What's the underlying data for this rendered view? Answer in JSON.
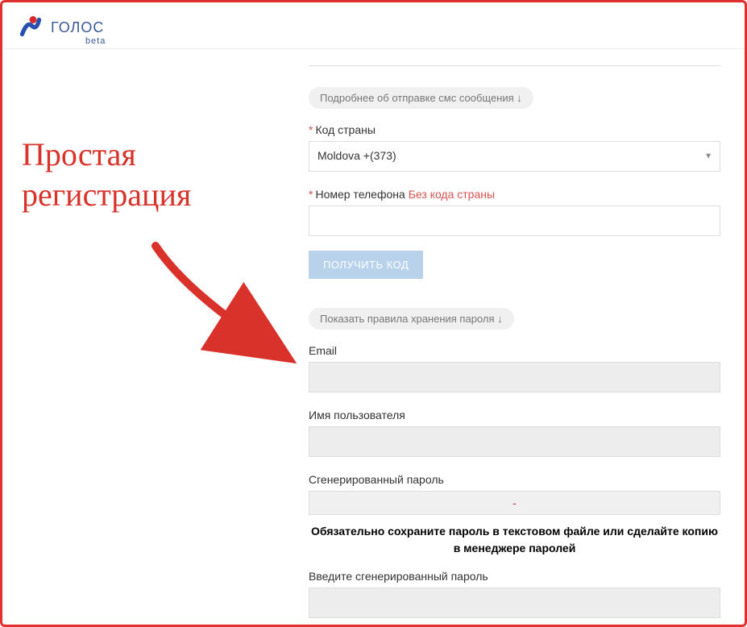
{
  "header": {
    "brand": "ГОЛОС",
    "beta": "beta"
  },
  "annotation": {
    "line1": "Простая",
    "line2": "регистрация"
  },
  "form": {
    "sms_more_label": "Подробнее об отправке смс сообщения ↓",
    "country_label": "Код страны",
    "country_value": "Moldova +(373)",
    "phone_label": "Номер телефона",
    "phone_hint": "Без кода страны",
    "get_code_button": "ПОЛУЧИТЬ КОД",
    "password_rules_label": "Показать правила хранения пароля ↓",
    "email_label": "Email",
    "email_value": "",
    "username_label": "Имя пользователя",
    "username_value": "",
    "gen_pass_label": "Сгенерированный пароль",
    "gen_pass_value": "-",
    "save_pass_notice": "Обязательно сохраните пароль в текстовом файле или сделайте копию в менеджере паролей",
    "enter_gen_pass_label": "Введите сгенерированный пароль",
    "enter_gen_pass_value": ""
  }
}
